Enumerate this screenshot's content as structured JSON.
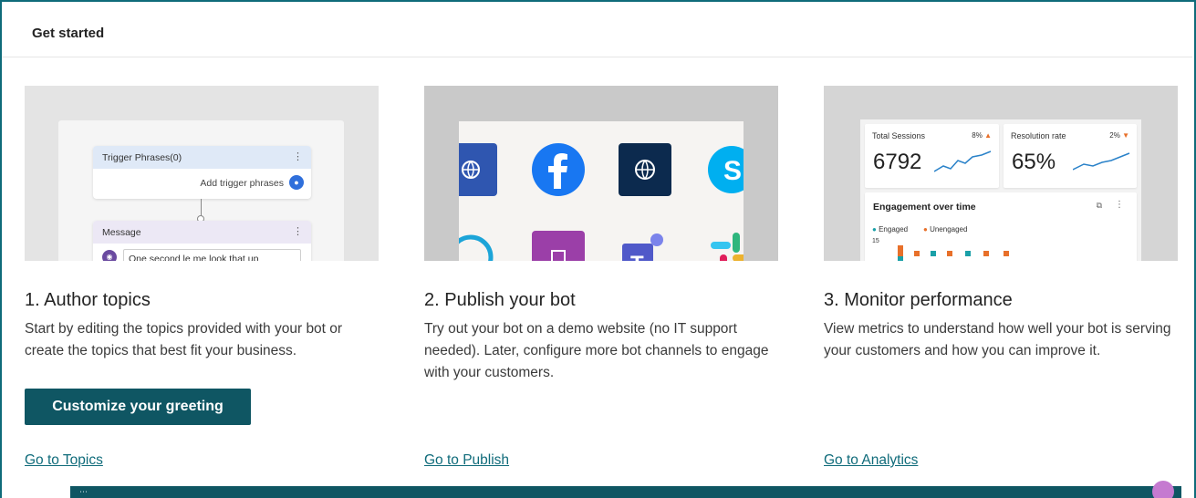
{
  "header": {
    "title": "Get started"
  },
  "columns": [
    {
      "title": "1. Author topics",
      "description": "Start by editing the topics provided with your bot or create the topics that best fit your business.",
      "button_label": "Customize your greeting",
      "link": "Go to Topics",
      "thumbnail": {
        "trigger_title": "Trigger Phrases(0)",
        "add_trigger": "Add trigger phrases",
        "message_title": "Message",
        "message_text": "One second le me look that up"
      }
    },
    {
      "title": "2. Publish your bot",
      "description": "Try out your bot on a demo website (no IT support needed). Later, configure more bot channels to engage with your customers.",
      "link": "Go to Publish",
      "thumbnail": {
        "channel_icons": [
          "web-chat-icon",
          "facebook-icon",
          "website-globe-icon",
          "skype-icon",
          "alexa-icon",
          "power-apps-icon",
          "teams-icon",
          "slack-icon"
        ]
      }
    },
    {
      "title": "3. Monitor performance",
      "description": "View metrics to understand how well your bot is serving your customers and how you can improve it.",
      "link": "Go to Analytics",
      "thumbnail": {
        "total_sessions_label": "Total Sessions",
        "total_sessions_delta": "8%",
        "total_sessions_value": "6792",
        "resolution_label": "Resolution rate",
        "resolution_delta": "2%",
        "resolution_value": "65%",
        "engagement_title": "Engagement over time",
        "legend_engaged": "Engaged",
        "legend_unengaged": "Unengaged",
        "y_tick": "15"
      }
    }
  ],
  "colors": {
    "accent": "#0f5663",
    "link": "#0f6b7a",
    "engaged": "#1aa0a8",
    "unengaged": "#e8702a"
  }
}
